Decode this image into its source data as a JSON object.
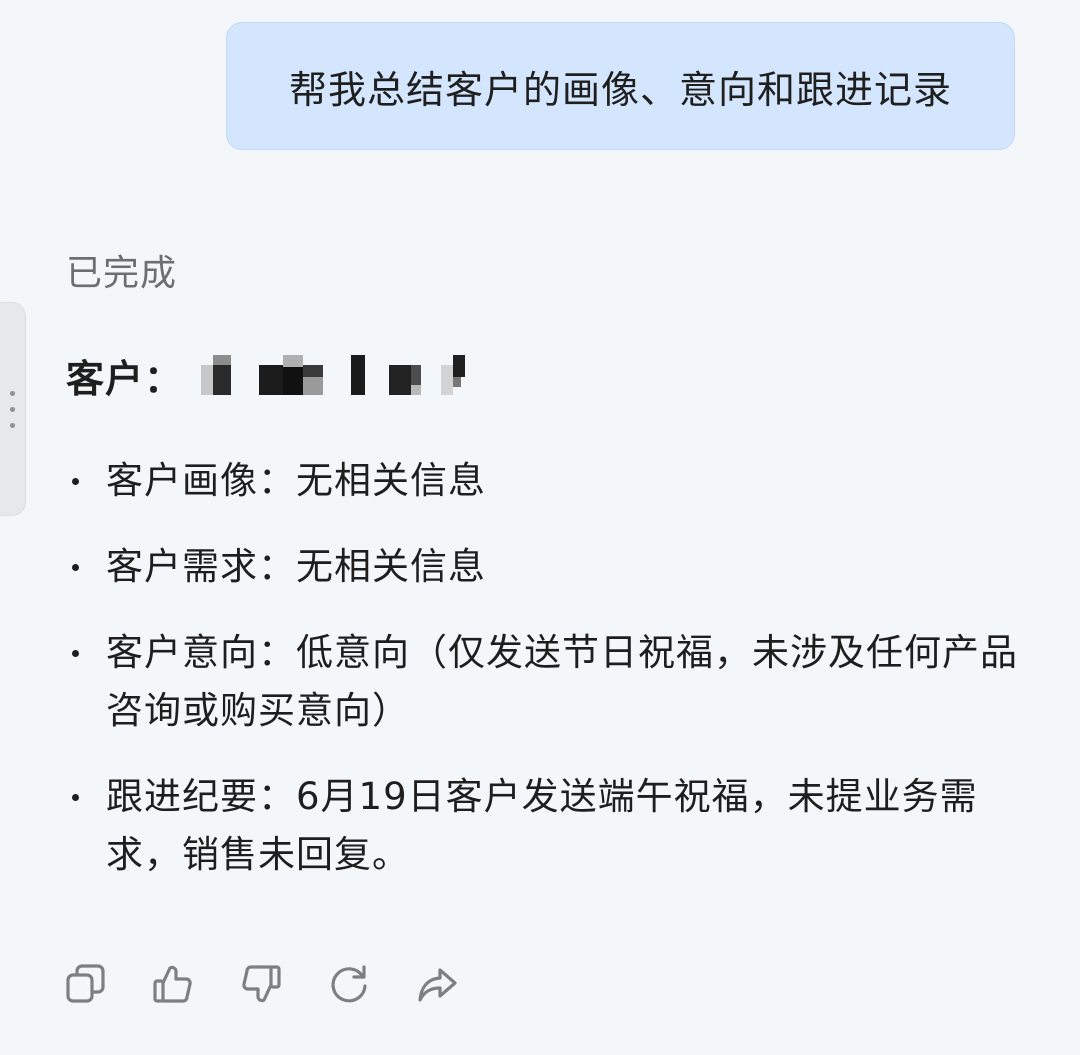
{
  "user_message": {
    "text": "帮我总结客户的画像、意向和跟进记录"
  },
  "assistant": {
    "status": "已完成",
    "customer_label": "客户：",
    "items": [
      {
        "text": "客户画像：无相关信息"
      },
      {
        "text": "客户需求：无相关信息"
      },
      {
        "text": "客户意向：低意向（仅发送节日祝福，未涉及任何产品咨询或购买意向）"
      },
      {
        "text": "跟进纪要：6月19日客户发送端午祝福，未提业务需求，销售未回复。"
      }
    ]
  },
  "actions": [
    {
      "icon": "copy-icon"
    },
    {
      "icon": "thumbs-up-icon"
    },
    {
      "icon": "thumbs-down-icon"
    },
    {
      "icon": "regenerate-icon"
    },
    {
      "icon": "share-icon"
    }
  ]
}
